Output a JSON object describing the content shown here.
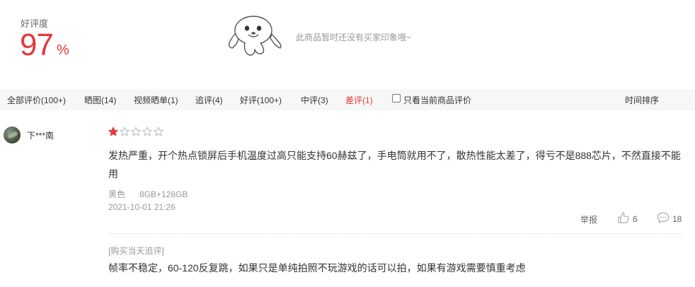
{
  "rating": {
    "label": "好评度",
    "value": "97",
    "unit": "%"
  },
  "impression": {
    "empty_text": "此商品暂时还没有买家印象哦~",
    "mascot_icon": "jd-dog-mascot"
  },
  "filters": {
    "items": [
      {
        "label": "全部评价(100+)"
      },
      {
        "label": "晒图(14)"
      },
      {
        "label": "视频晒单(1)"
      },
      {
        "label": "追评(4)"
      },
      {
        "label": "好评(100+)"
      },
      {
        "label": "中评(3)"
      },
      {
        "label": "差评(1)",
        "active": true
      }
    ],
    "only_current_label": "只看当前商品评价",
    "only_current_checked": false,
    "sort_label": "时间排序"
  },
  "review": {
    "username": "下***南",
    "stars": 1,
    "max_stars": 5,
    "text": "发热严重，开个热点锁屏后手机温度过高只能支持60赫兹了，手电筒就用不了，散热性能太差了，得亏不是888芯片，不然直接不能用",
    "color": "黑色",
    "spec": "8GB+128GB",
    "date": "2021-10-01 21:26",
    "report_label": "举报",
    "likes": "6",
    "comments": "18",
    "append_title": "[购买当天追评]",
    "append_text": "帧率不稳定，60-120反复跳，如果只是单纯拍照不玩游戏的话可以拍，如果有游戏需要慎重考虑"
  },
  "colors": {
    "accent": "#e4393c",
    "muted": "#999999",
    "star_filled": "#e4393c",
    "star_empty": "#bbbbbb"
  }
}
